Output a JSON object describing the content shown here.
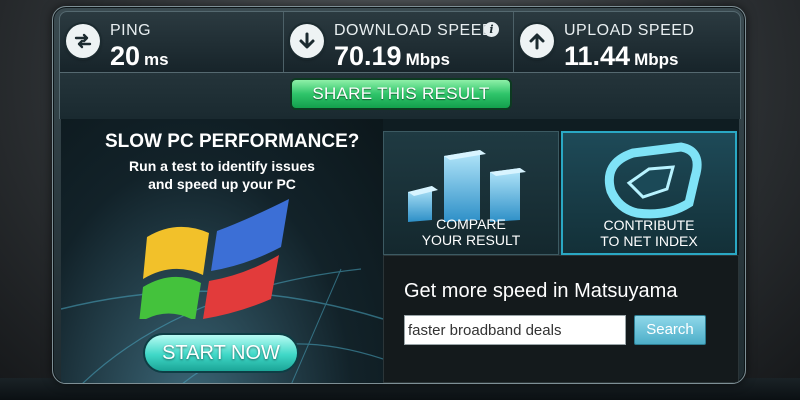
{
  "stats": {
    "ping": {
      "label": "PING",
      "value": "20",
      "unit": "ms",
      "icon": "ping-exchange-icon"
    },
    "download": {
      "label": "DOWNLOAD SPEED",
      "value": "70.19",
      "unit": "Mbps",
      "icon": "download-arrow-icon",
      "info": "i"
    },
    "upload": {
      "label": "UPLOAD SPEED",
      "value": "11.44",
      "unit": "Mbps",
      "icon": "upload-arrow-icon"
    }
  },
  "share": {
    "label": "SHARE THIS RESULT"
  },
  "ad": {
    "title": "SLOW PC PERFORMANCE?",
    "desc_line1": "Run a test to identify issues",
    "desc_line2": "and speed up your PC",
    "cta": "START NOW"
  },
  "tiles": {
    "compare": {
      "line1": "COMPARE",
      "line2": "YOUR RESULT",
      "icon": "bar-chart-icon"
    },
    "contribute": {
      "line1": "CONTRIBUTE",
      "line2": "TO NET INDEX",
      "icon": "net-index-icon"
    }
  },
  "search": {
    "title": "Get more speed in Matsuyama",
    "input_value": "faster broadband deals",
    "button": "Search"
  },
  "colors": {
    "accent_green": "#2fc46a",
    "accent_teal": "#3fd8c7",
    "panel_dark": "#141a1c",
    "search_blue": "#4daec8"
  }
}
